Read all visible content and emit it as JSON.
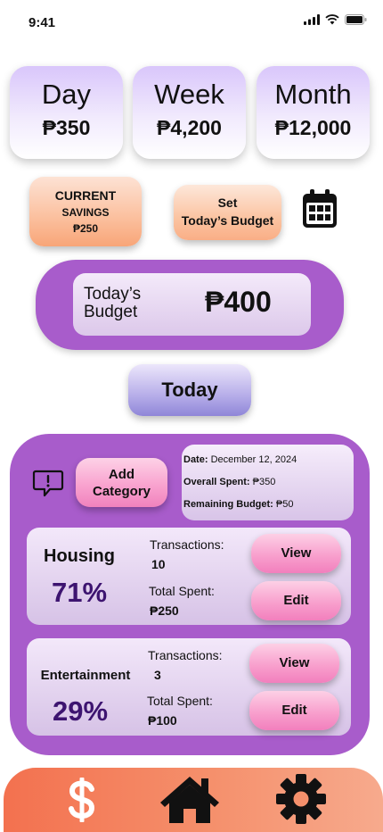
{
  "status_bar": {
    "time": "9:41"
  },
  "periods": [
    {
      "label": "Day",
      "value": "₱350"
    },
    {
      "label": "Week",
      "value": "₱4,200"
    },
    {
      "label": "Month",
      "value": "₱12,000"
    }
  ],
  "savings": {
    "title": "CURRENT",
    "subtitle": "SAVINGS",
    "value": "₱250"
  },
  "set_budget": {
    "line1": "Set",
    "line2": "Today’s Budget"
  },
  "budget": {
    "label_line1": "Today’s",
    "label_line2": "Budget",
    "value": "₱400"
  },
  "today_button": "Today",
  "add_category": {
    "line1": "Add",
    "line2": "Category"
  },
  "info": {
    "date_label": "Date:",
    "date_value": "December 12, 2024",
    "spent_label": "Overall Spent:",
    "spent_value": "₱350",
    "remaining_label": "Remaining Budget:",
    "remaining_value": "₱50"
  },
  "categories": [
    {
      "name": "Housing",
      "percent": "71%",
      "tx_label": "Transactions:",
      "tx_value": "10",
      "spent_label": "Total Spent:",
      "spent_value": "₱250",
      "view_label": "View",
      "edit_label": "Edit"
    },
    {
      "name": "Entertainment",
      "percent": "29%",
      "tx_label": "Transactions:",
      "tx_value": "3",
      "spent_label": "Total Spent:",
      "spent_value": "₱100",
      "view_label": "View",
      "edit_label": "Edit"
    }
  ],
  "nav": {
    "items": [
      {
        "icon": "dollar-icon"
      },
      {
        "icon": "home-icon"
      },
      {
        "icon": "gear-icon"
      }
    ]
  },
  "colors": {
    "panel_purple": "#a85ccb",
    "nav_orange": "#f3714f",
    "percent_text": "#3d1470"
  }
}
